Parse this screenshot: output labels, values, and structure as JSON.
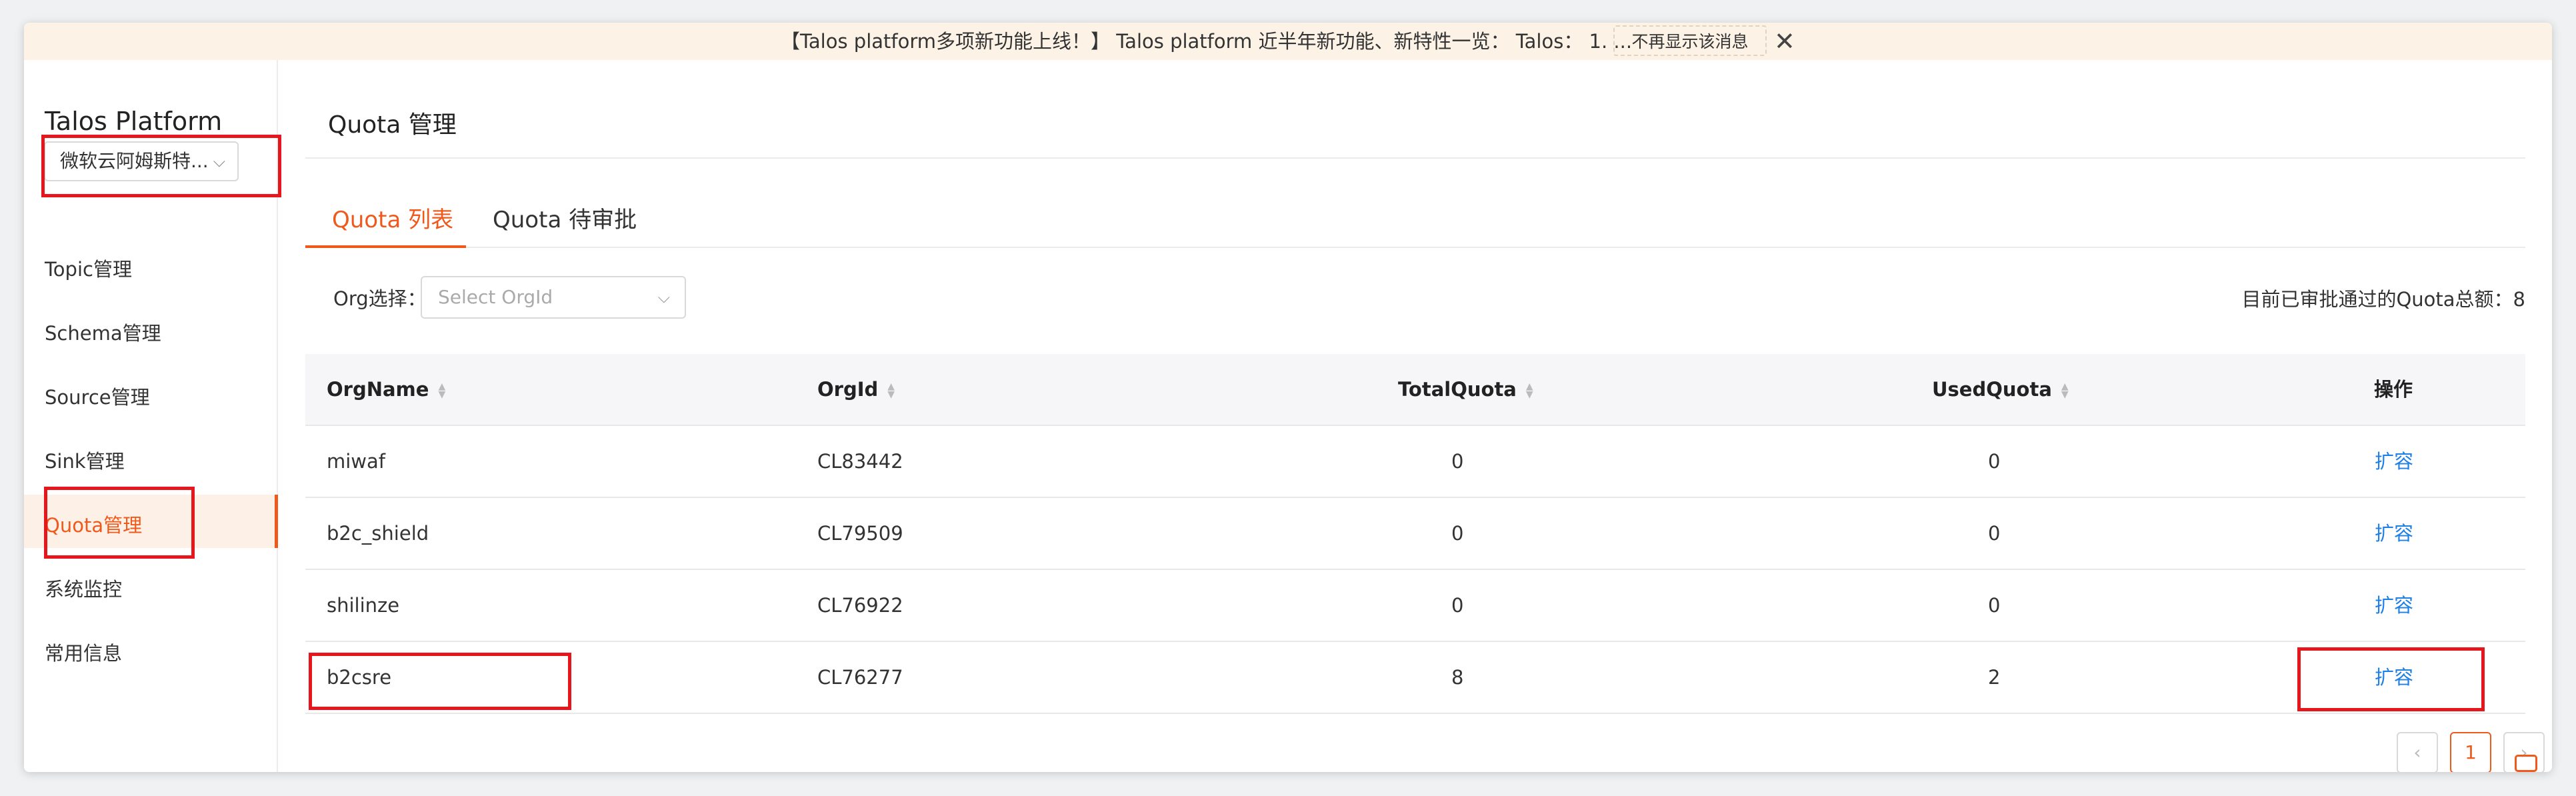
{
  "notice": {
    "text": "【Talos platform多项新功能上线！】 Talos platform 近半年新功能、新特性一览： Talos： 1. ...",
    "dismiss_label": "不再显示该消息",
    "close_glyph": "✕"
  },
  "sidebar": {
    "brand": "Talos Platform",
    "env_select": "微软云阿姆斯特...",
    "chevron": "⌵",
    "items": [
      {
        "label": "Topic管理"
      },
      {
        "label": "Schema管理"
      },
      {
        "label": "Source管理"
      },
      {
        "label": "Sink管理"
      },
      {
        "label": "Quota管理"
      },
      {
        "label": "系统监控"
      },
      {
        "label": "常用信息"
      }
    ]
  },
  "main": {
    "title": "Quota 管理",
    "tabs": [
      {
        "label": "Quota 列表"
      },
      {
        "label": "Quota 待审批"
      }
    ],
    "org_label": "Org选择：",
    "org_placeholder": "Select OrgId",
    "total_text": "目前已审批通过的Quota总额：8"
  },
  "table": {
    "columns": [
      "OrgName",
      "OrgId",
      "TotalQuota",
      "UsedQuota",
      "操作"
    ],
    "rows": [
      {
        "org_name": "miwaf",
        "org_id": "CL83442",
        "total": "0",
        "used": "0",
        "action": "扩容"
      },
      {
        "org_name": "b2c_shield",
        "org_id": "CL79509",
        "total": "0",
        "used": "0",
        "action": "扩容"
      },
      {
        "org_name": "shilinze",
        "org_id": "CL76922",
        "total": "0",
        "used": "0",
        "action": "扩容"
      },
      {
        "org_name": "b2csre",
        "org_id": "CL76277",
        "total": "8",
        "used": "2",
        "action": "扩容"
      }
    ]
  },
  "pagination": {
    "prev": "‹",
    "current": "1",
    "next": "›"
  },
  "colors": {
    "accent": "#ef5a1c",
    "link": "#1e80e6",
    "highlight": "#e5171d"
  }
}
